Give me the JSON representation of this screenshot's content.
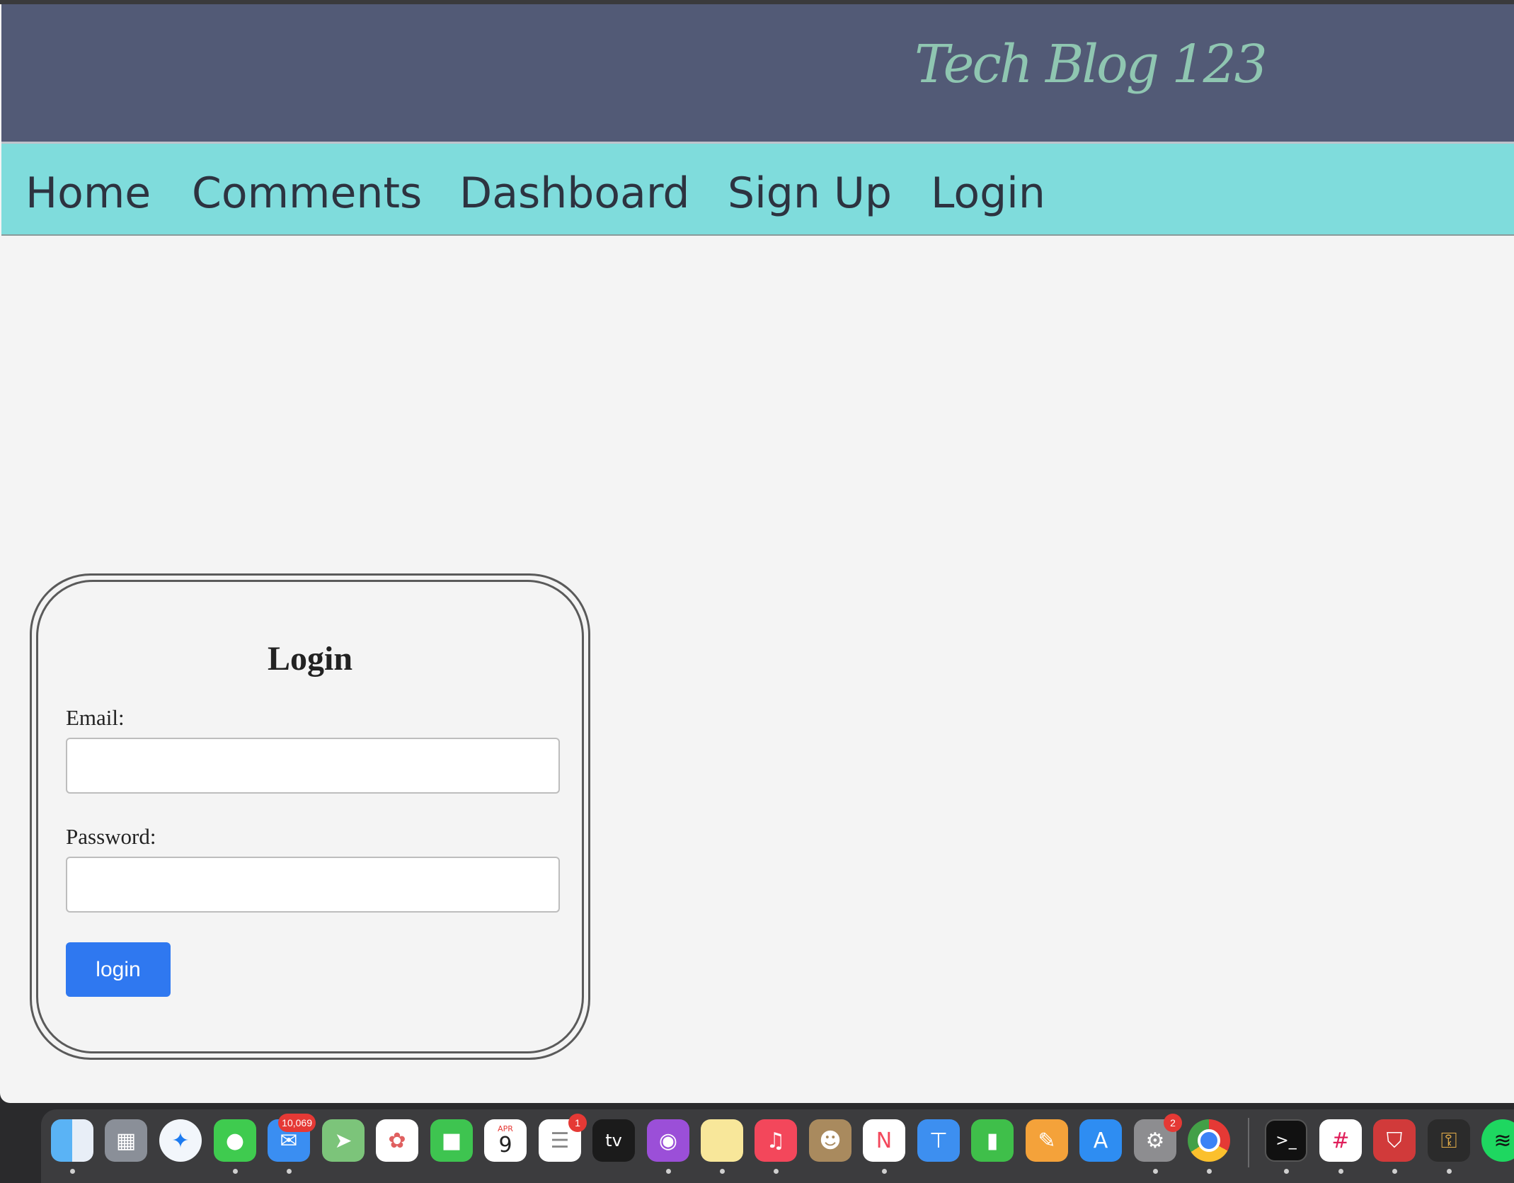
{
  "header": {
    "brand": "Tech Blog 123"
  },
  "nav": {
    "items": [
      "Home",
      "Comments",
      "Dashboard",
      "Sign Up",
      "Login"
    ]
  },
  "login_form": {
    "title": "Login",
    "email_label": "Email:",
    "email_value": "",
    "password_label": "Password:",
    "password_value": "",
    "submit_label": "login"
  },
  "dock": {
    "mail_badge": "10,069",
    "calendar_month": "APR",
    "calendar_day": "9",
    "reminders_badge": "1",
    "tv_label": "tv",
    "settings_badge": "2"
  },
  "colors": {
    "header_bg": "#525a76",
    "brand_text": "#8fc6b1",
    "nav_bg": "#7fdcdc",
    "page_bg": "#f4f4f4",
    "button_bg": "#2f78f0"
  }
}
